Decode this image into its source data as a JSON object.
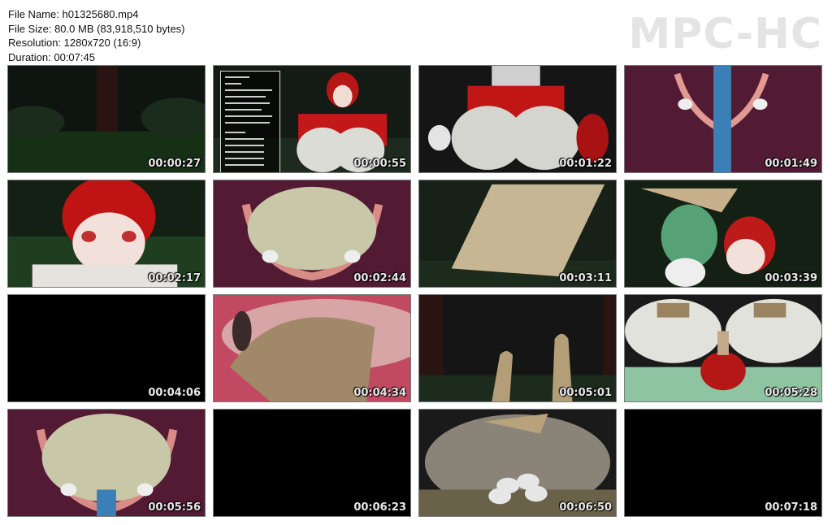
{
  "info": {
    "file_name": "File Name: h01325680.mp4",
    "file_size": "File Size: 80.0 MB (83,918,510 bytes)",
    "resolution": "Resolution: 1280x720 (16:9)",
    "duration": "Duration: 00:07:45"
  },
  "logo": "MPC-HC",
  "thumbnails": [
    {
      "time": "00:00:27"
    },
    {
      "time": "00:00:55"
    },
    {
      "time": "00:01:22"
    },
    {
      "time": "00:01:49"
    },
    {
      "time": "00:02:17"
    },
    {
      "time": "00:02:44"
    },
    {
      "time": "00:03:11"
    },
    {
      "time": "00:03:39"
    },
    {
      "time": "00:04:06"
    },
    {
      "time": "00:04:34"
    },
    {
      "time": "00:05:01"
    },
    {
      "time": "00:05:28"
    },
    {
      "time": "00:05:56"
    },
    {
      "time": "00:06:23"
    },
    {
      "time": "00:06:50"
    },
    {
      "time": "00:07:18"
    }
  ]
}
